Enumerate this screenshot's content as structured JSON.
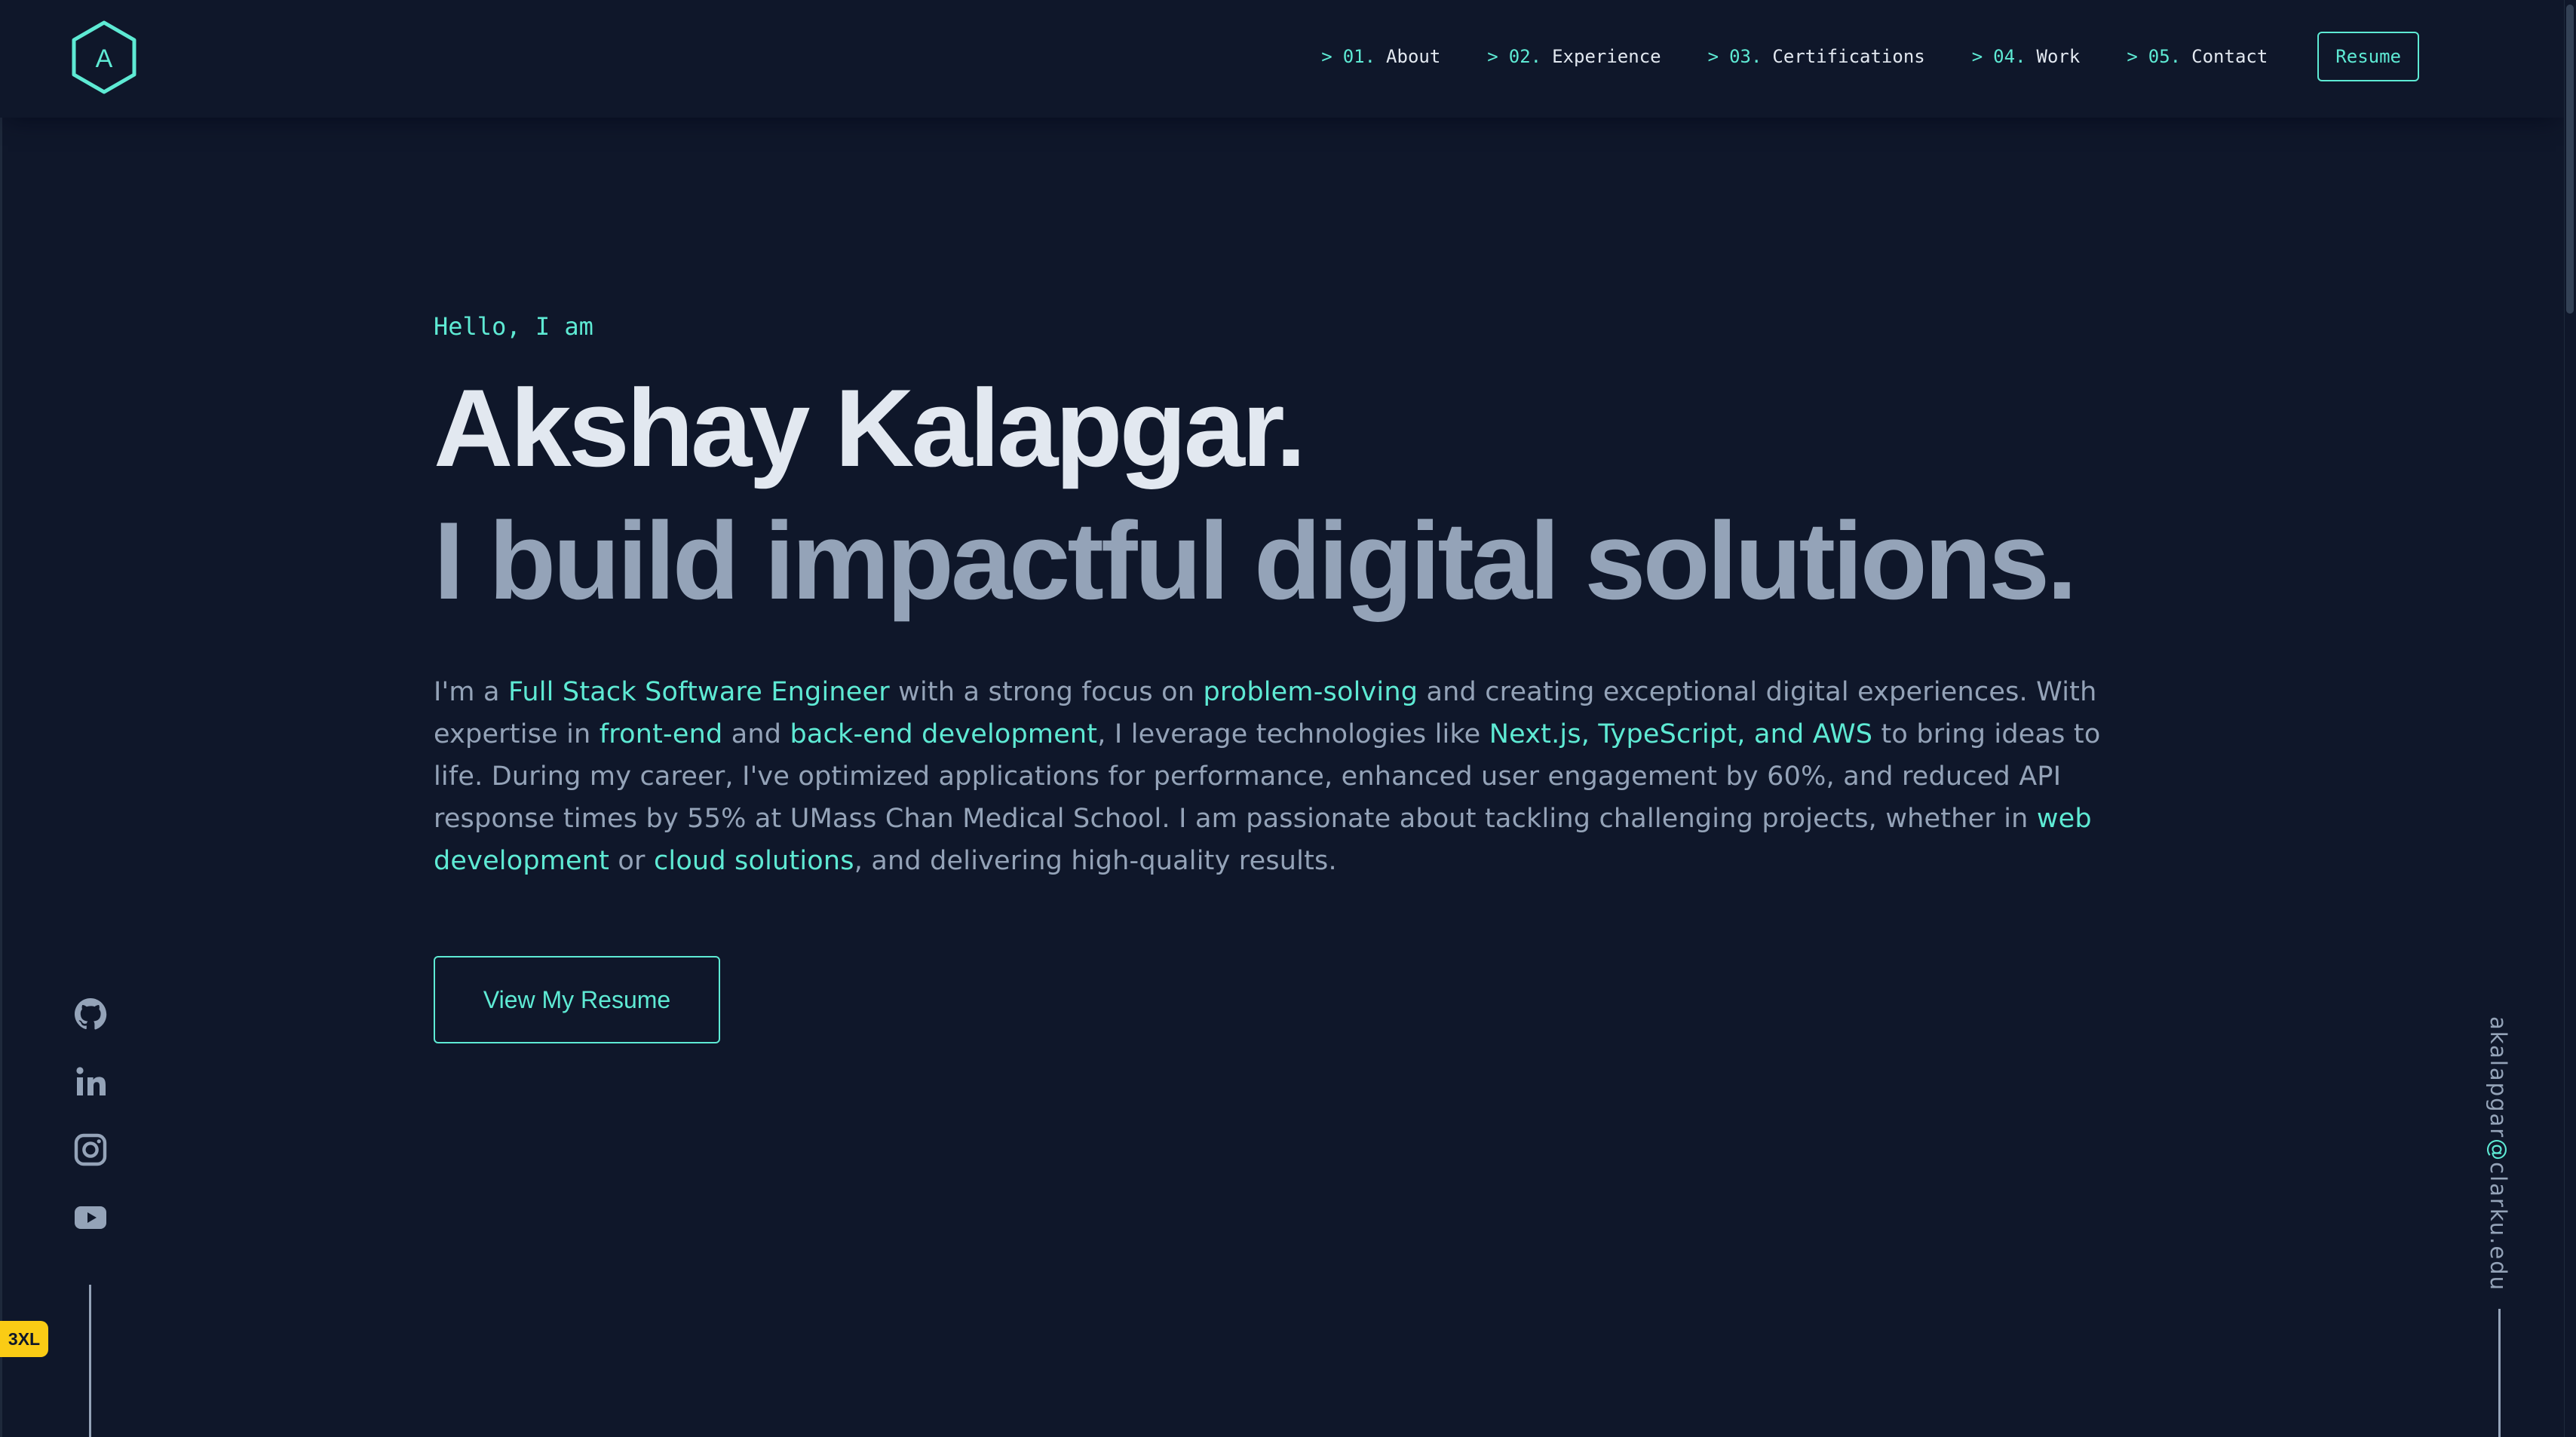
{
  "logo": {
    "letter": "A",
    "icon": "hexagon-logo-icon"
  },
  "nav": {
    "items": [
      {
        "prefix": ">",
        "num": "01.",
        "label": "About"
      },
      {
        "prefix": ">",
        "num": "02.",
        "label": "Experience"
      },
      {
        "prefix": ">",
        "num": "03.",
        "label": "Certifications"
      },
      {
        "prefix": ">",
        "num": "04.",
        "label": "Work"
      },
      {
        "prefix": ">",
        "num": "05.",
        "label": "Contact"
      }
    ],
    "resume_label": "Resume"
  },
  "hero": {
    "greeting": "Hello, I am",
    "name": "Akshay Kalapgar.",
    "tagline": "I build impactful digital solutions.",
    "bio": {
      "t1": "I'm a ",
      "h1": "Full Stack Software Engineer",
      "t2": " with a strong focus on ",
      "h2": "problem-solving",
      "t3": " and creating exceptional digital experiences. With expertise in ",
      "h3": "front-end",
      "t4": " and ",
      "h4": "back-end development",
      "t5": ", I leverage technologies like ",
      "h5": "Next.js, TypeScript, and AWS",
      "t6": " to bring ideas to life. During my career, I've optimized applications for performance, enhanced user engagement by 60%, and reduced API response times by 55% at UMass Chan Medical School. I am passionate about tackling challenging projects, whether in ",
      "h6": "web development",
      "t7": " or ",
      "h7": "cloud solutions",
      "t8": ", and delivering high-quality results."
    },
    "cta_label": "View My Resume"
  },
  "social": {
    "icons": [
      "github-icon",
      "linkedin-icon",
      "instagram-icon",
      "youtube-icon"
    ]
  },
  "email": {
    "user": "akalapgar",
    "at": "@",
    "domain": "clarku.edu"
  },
  "badge": "3XL",
  "colors": {
    "background": "#0f172a",
    "accent": "#5eead4",
    "heading": "#e2e8f0",
    "muted": "#94a3b8",
    "badge": "#facc15"
  }
}
